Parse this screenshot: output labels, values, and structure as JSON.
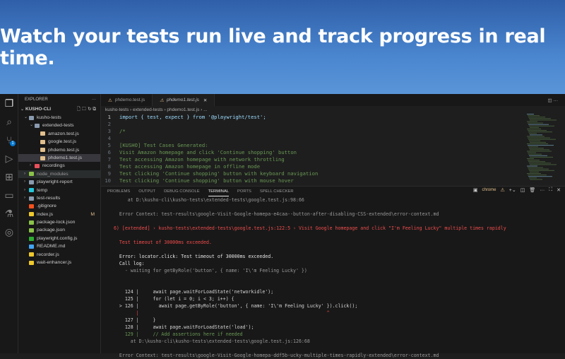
{
  "banner": {
    "headline": "Watch your tests run live and track progress in real time."
  },
  "activity": {
    "items": [
      "explorer-icon",
      "search-icon",
      "source-control-icon",
      "run-debug-icon",
      "extensions-icon",
      "remote-icon",
      "testing-icon",
      "browser-icon"
    ],
    "scm_badge": "1"
  },
  "sidebar": {
    "title": "EXPLORER",
    "more": "···",
    "root": "KUSHO-CLI",
    "items": [
      {
        "label": "kusho-tests",
        "chev": "⌄",
        "color": "#8a9bb0",
        "indent": 1
      },
      {
        "label": "extended-tests",
        "chev": "⌄",
        "color": "#8a9bb0",
        "indent": 2
      },
      {
        "label": "amazon.test.js",
        "chev": "",
        "color": "#e2c08d",
        "indent": 3
      },
      {
        "label": "google.test.js",
        "chev": "",
        "color": "#e2c08d",
        "indent": 3
      },
      {
        "label": "phdemo.test.js",
        "chev": "",
        "color": "#e2c08d",
        "indent": 3
      },
      {
        "label": "phdemo1.test.js",
        "chev": "",
        "color": "#e2c08d",
        "indent": 3
      },
      {
        "label": "recordings",
        "chev": "›",
        "color": "#e8505b",
        "indent": 2
      },
      {
        "label": "node_modules",
        "chev": "›",
        "color": "#8bc34a",
        "indent": 1
      },
      {
        "label": "playwright-report",
        "chev": "›",
        "color": "#8a9bb0",
        "indent": 1
      },
      {
        "label": "temp",
        "chev": "›",
        "color": "#26c6da",
        "indent": 1
      },
      {
        "label": "test-results",
        "chev": "›",
        "color": "#8a9bb0",
        "indent": 1
      },
      {
        "label": ".gitignore",
        "chev": "",
        "color": "#f4511e",
        "indent": 1
      },
      {
        "label": "index.js",
        "chev": "",
        "color": "#f0c92c",
        "indent": 1,
        "status": "M"
      },
      {
        "label": "package-lock.json",
        "chev": "",
        "color": "#8bc34a",
        "indent": 1
      },
      {
        "label": "package.json",
        "chev": "",
        "color": "#8bc34a",
        "indent": 1
      },
      {
        "label": "playwright.config.js",
        "chev": "",
        "color": "#2ead33",
        "indent": 1
      },
      {
        "label": "README.md",
        "chev": "",
        "color": "#42a5f5",
        "indent": 1
      },
      {
        "label": "recorder.js",
        "chev": "",
        "color": "#f0c92c",
        "indent": 1
      },
      {
        "label": "wait-enhancer.js",
        "chev": "",
        "color": "#f0c92c",
        "indent": 1
      }
    ]
  },
  "editor": {
    "tabs": [
      {
        "label": "phdemo.test.js"
      },
      {
        "label": "phdemo1.test.js",
        "close": "✕"
      }
    ],
    "breadcrumb": "kusho-tests › extended-tests › phdemo1.test.js › ...",
    "lines": [
      {
        "n": "1",
        "t": "import { test, expect } from '@playwright/test';"
      },
      {
        "n": "2",
        "t": ""
      },
      {
        "n": "3",
        "t": "/*"
      },
      {
        "n": "4",
        "t": ""
      },
      {
        "n": "5",
        "t": "[KUSHO] Test Cases Generated:"
      },
      {
        "n": "6",
        "t": "Visit Amazon homepage and click 'Continue shopping' button"
      },
      {
        "n": "7",
        "t": "Test accessing Amazon homepage with network throttling"
      },
      {
        "n": "8",
        "t": "Test accessing Amazon homepage in offline mode"
      },
      {
        "n": "9",
        "t": "Test clicking 'Continue shopping' button with keyboard navigation"
      },
      {
        "n": "10",
        "t": "Test clicking 'Continue shopping' button with mouse hover"
      }
    ]
  },
  "panel": {
    "tabs": [
      "PROBLEMS",
      "OUTPUT",
      "DEBUG CONSOLE",
      "TERMINAL",
      "PORTS",
      "SPELL CHECKER"
    ],
    "active": "TERMINAL",
    "terminal_name": "chrome",
    "lines": [
      "       at D:\\kusho-cli\\kusho-tests\\extended-tests\\google.test.js:98:66",
      "",
      "    Error Context: test-results\\google-Visit-Google-homepa-e4caa--button-after-disabling-CSS-extended\\error-context.md",
      "",
      "  6) [extended] › kusho-tests\\extended-tests\\google.test.js:122:5 › Visit Google homepage and click \"I'm Feeling Lucky\" multiple times rapidly",
      "",
      "    Test timeout of 30000ms exceeded.",
      "",
      "    Error: locator.click: Test timeout of 30000ms exceeded.",
      "    Call log:",
      "      - waiting for getByRole('button', { name: 'I\\'m Feeling Lucky' })",
      "",
      "",
      "      124 |     await page.waitForLoadState('networkidle');",
      "      125 |     for (let i = 0; i < 3; i++) {",
      "    > 126 |       await page.getByRole('button', { name: 'I\\'m Feeling Lucky' }).click();",
      "          |                                                                   ^",
      "      127 |     }",
      "      128 |     await page.waitForLoadState('load');",
      "      129 |     // Add assertions here if needed",
      "        at D:\\kusho-cli\\kusho-tests\\extended-tests\\google.test.js:126:68",
      "",
      "    Error Context: test-results\\google-Visit-Google-homepa-ddf5b-ucky-multiple-times-rapidly-extended\\error-context.md"
    ],
    "line_classes": [
      "g",
      "",
      "g",
      "",
      "r",
      "",
      "r",
      "",
      "w",
      "w",
      "g",
      "",
      "",
      "pl",
      "pl",
      "pl",
      "r",
      "pl",
      "pl",
      "cm",
      "g",
      "",
      "g"
    ]
  }
}
